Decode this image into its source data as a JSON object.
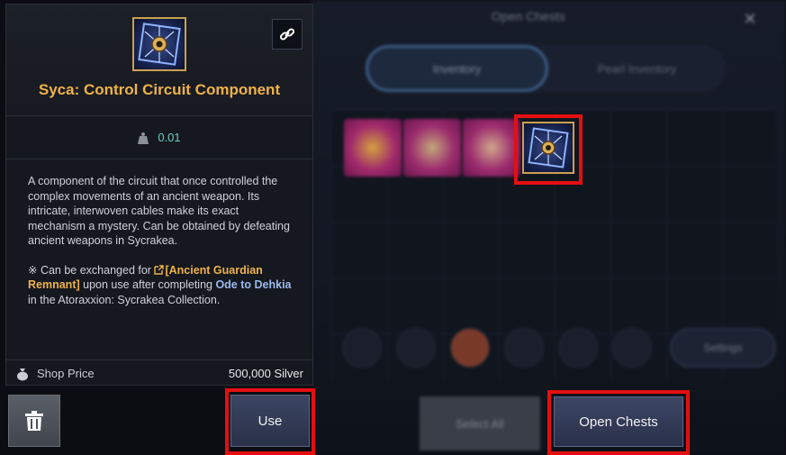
{
  "background_window": {
    "title": "Open Chests",
    "close_glyph": "✕",
    "tabs": [
      "Inventory",
      "Pearl Inventory"
    ],
    "settings_label": "Settings",
    "select_all_label": "Select All"
  },
  "item": {
    "name": "Syca: Control Circuit Component",
    "weight": "0.01",
    "description": "A component of the circuit that once controlled the complex movements of an ancient weapon. Its intricate, interwoven cables make its exact mechanism a mystery. Can be obtained by defeating ancient weapons in Sycrakea.",
    "exchange_prefix": "※ Can be exchanged for ",
    "exchange_item": "[Ancient Guardian Remnant]",
    "exchange_mid": " upon use after completing ",
    "exchange_quest": "Ode to Dehkia",
    "exchange_suffix": " in the Atoraxxion: Sycrakea Collection.",
    "shop_price_label": "Shop Price",
    "shop_price_value": "500,000 Silver"
  },
  "buttons": {
    "use_label": "Use",
    "open_chests_label": "Open Chests"
  },
  "colors": {
    "accent_gold": "#f0b24a",
    "highlight_red": "#e40f10",
    "weight_teal": "#69d1c4",
    "quest_blue": "#9db9f0"
  },
  "icons": [
    "link-icon",
    "weight-icon",
    "silver-bag-icon",
    "trash-icon",
    "external-link-icon",
    "close-icon"
  ]
}
